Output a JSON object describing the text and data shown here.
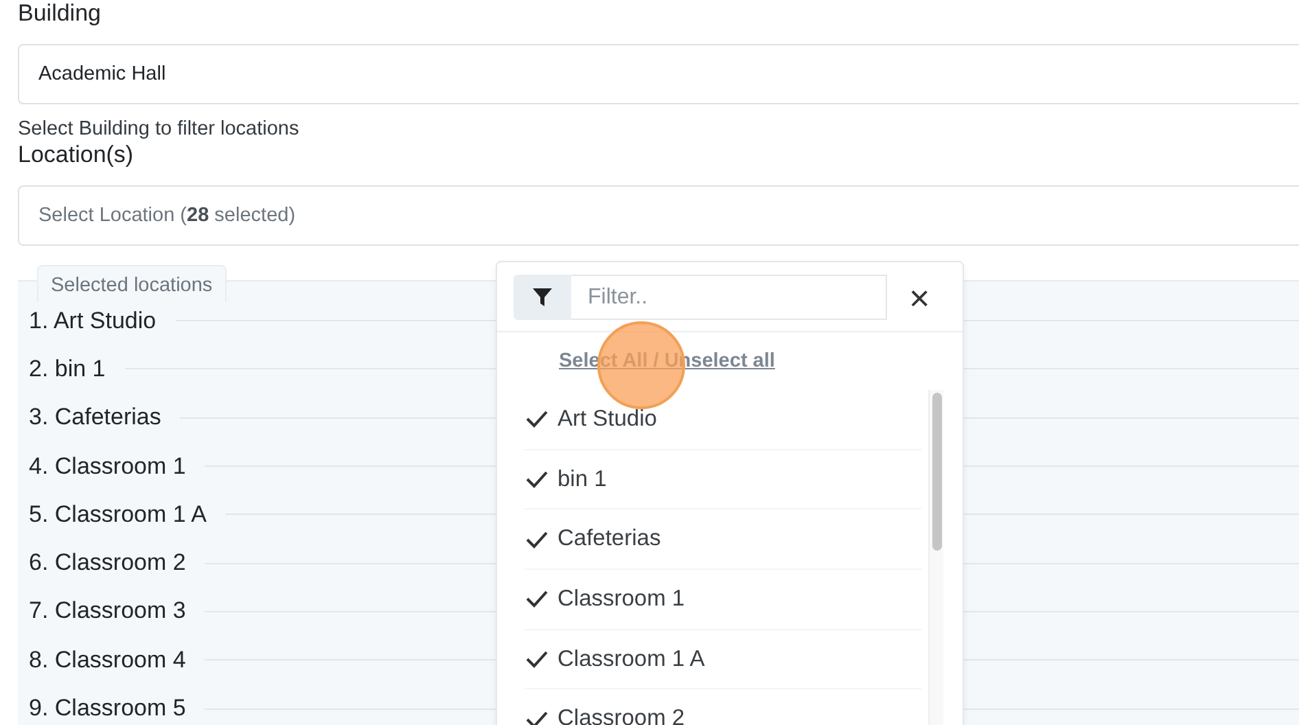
{
  "building": {
    "label": "Building",
    "value": "Academic Hall",
    "help": "Select Building to filter locations"
  },
  "locations": {
    "label": "Location(s)",
    "summary": "Select Location (**28** selected)"
  },
  "selected_panel": {
    "title": "Selected locations",
    "items": [
      "1. Art Studio",
      "2. bin 1",
      "3. Cafeterias",
      "4. Classroom 1",
      "5. Classroom 1 A",
      "6. Classroom 2",
      "7. Classroom 3",
      "8. Classroom 4",
      "9. Classroom 5"
    ]
  },
  "dropdown": {
    "filter_placeholder": "Filter..",
    "close": "×",
    "select_all_link": "Select All / Unselect all",
    "options": [
      {
        "label": "Art Studio",
        "checked": true
      },
      {
        "label": "bin 1",
        "checked": true
      },
      {
        "label": "Cafeterias",
        "checked": true
      },
      {
        "label": "Classroom 1",
        "checked": true
      },
      {
        "label": "Classroom 1 A",
        "checked": true
      },
      {
        "label": "Classroom 2",
        "checked": true
      }
    ]
  }
}
